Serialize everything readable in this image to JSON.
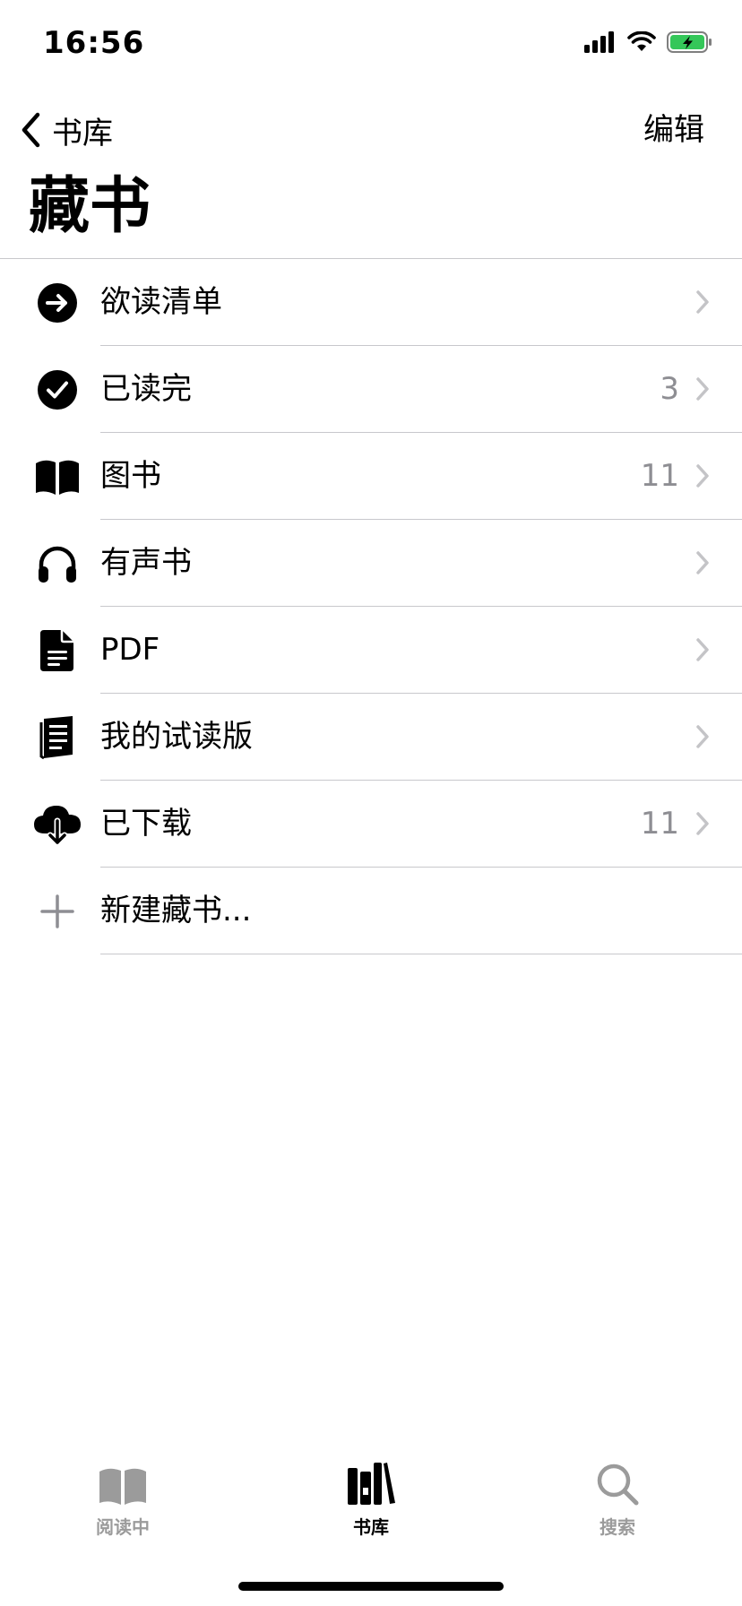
{
  "status_bar": {
    "time": "16:56"
  },
  "nav": {
    "back_label": "书库",
    "edit_label": "编辑"
  },
  "page": {
    "title": "藏书"
  },
  "collections": [
    {
      "label": "欲读清单",
      "icon": "arrow-circle-icon",
      "count": ""
    },
    {
      "label": "已读完",
      "icon": "checkmark-circle-icon",
      "count": "3"
    },
    {
      "label": "图书",
      "icon": "open-book-icon",
      "count": "11"
    },
    {
      "label": "有声书",
      "icon": "headphones-icon",
      "count": ""
    },
    {
      "label": "PDF",
      "icon": "document-icon",
      "count": ""
    },
    {
      "label": "我的试读版",
      "icon": "sample-book-icon",
      "count": ""
    },
    {
      "label": "已下载",
      "icon": "cloud-download-icon",
      "count": "11"
    },
    {
      "label": "新建藏书...",
      "icon": "plus-icon",
      "count": ""
    }
  ],
  "tabs": [
    {
      "label": "阅读中",
      "active": false
    },
    {
      "label": "书库",
      "active": true
    },
    {
      "label": "搜索",
      "active": false
    }
  ],
  "colors": {
    "accent": "#000000",
    "secondary_text": "#8e8e93",
    "separator": "#c8c8cc",
    "battery": "#34c759",
    "tab_inactive": "#9b9b9b"
  }
}
